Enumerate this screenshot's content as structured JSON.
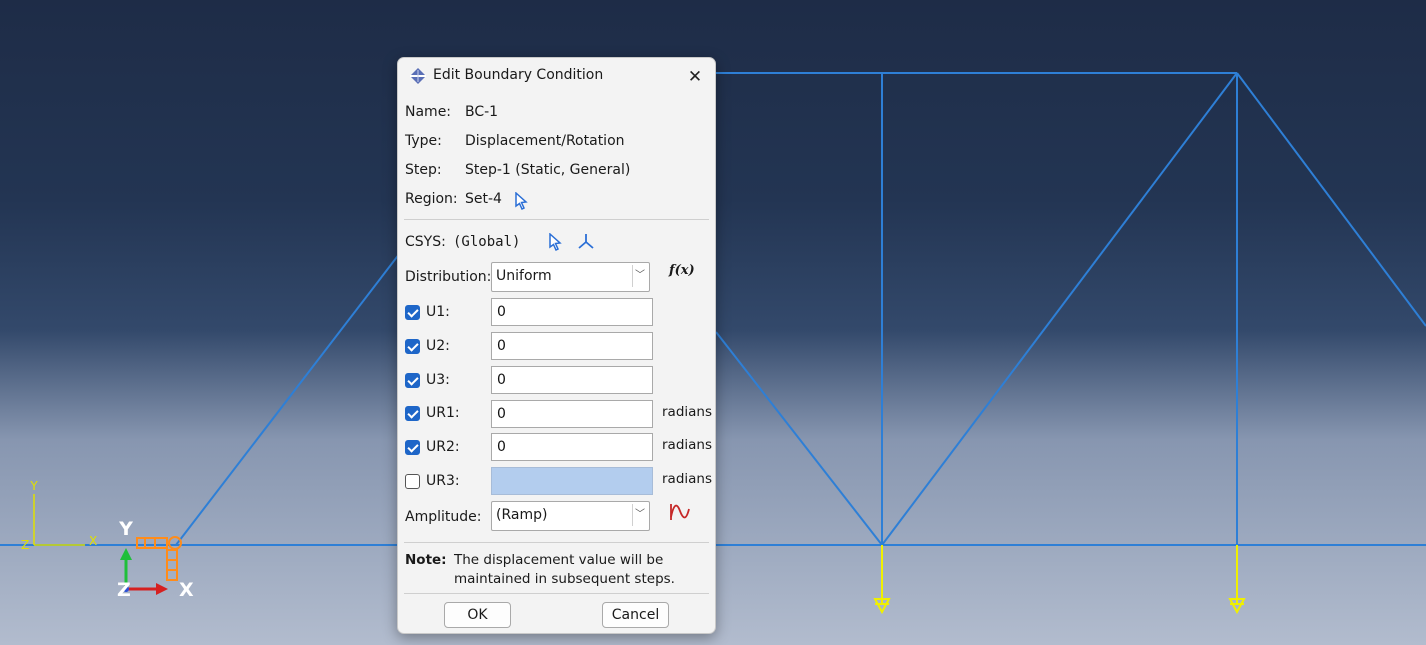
{
  "dialog": {
    "title": "Edit Boundary Condition",
    "name_label": "Name:",
    "name_value": "BC-1",
    "type_label": "Type:",
    "type_value": "Displacement/Rotation",
    "step_label": "Step:",
    "step_value": "Step-1 (Static, General)",
    "region_label": "Region:",
    "region_value": "Set-4",
    "csys_label": "CSYS:",
    "csys_value": "(Global)",
    "distribution_label": "Distribution:",
    "distribution_value": "Uniform",
    "fx_label": "f(x)",
    "dofs": [
      {
        "label": "U1:",
        "checked": true,
        "value": "0",
        "unit": ""
      },
      {
        "label": "U2:",
        "checked": true,
        "value": "0",
        "unit": ""
      },
      {
        "label": "U3:",
        "checked": true,
        "value": "0",
        "unit": ""
      },
      {
        "label": "UR1:",
        "checked": true,
        "value": "0",
        "unit": "radians"
      },
      {
        "label": "UR2:",
        "checked": true,
        "value": "0",
        "unit": "radians"
      },
      {
        "label": "UR3:",
        "checked": false,
        "value": "",
        "unit": "radians"
      }
    ],
    "amplitude_label": "Amplitude:",
    "amplitude_value": "(Ramp)",
    "note_label": "Note:",
    "note_line1": "The displacement value will be",
    "note_line2": "maintained in subsequent steps.",
    "ok_label": "OK",
    "cancel_label": "Cancel"
  },
  "viewport": {
    "triad_small": {
      "y": "Y",
      "x": "X",
      "z": "Z"
    },
    "triad_large": {
      "y": "Y",
      "x": "X",
      "z": "Z"
    },
    "colors": {
      "truss": "#2e7fd6",
      "load": "#f0f000",
      "bc": "#ff8c1a"
    }
  }
}
